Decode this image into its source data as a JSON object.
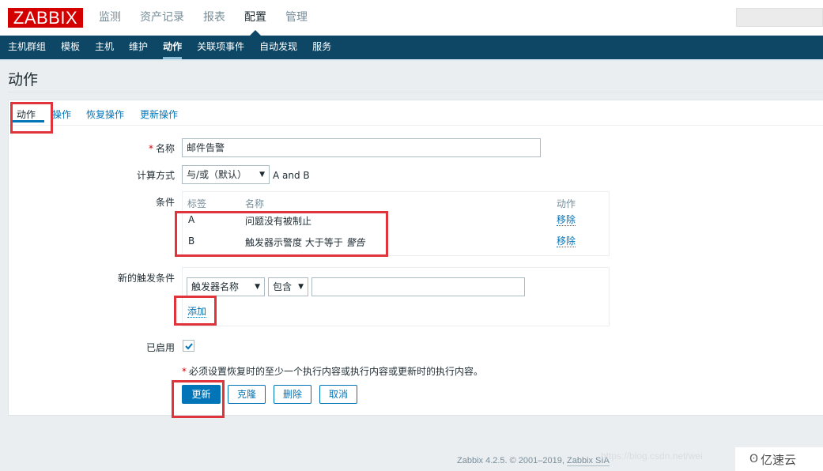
{
  "app": {
    "logo": "ZABBIX",
    "top_menu": [
      {
        "label": "监测",
        "active": false
      },
      {
        "label": "资产记录",
        "active": false
      },
      {
        "label": "报表",
        "active": false
      },
      {
        "label": "配置",
        "active": true
      },
      {
        "label": "管理",
        "active": false
      }
    ],
    "sub_menu": [
      {
        "label": "主机群组",
        "active": false
      },
      {
        "label": "模板",
        "active": false
      },
      {
        "label": "主机",
        "active": false
      },
      {
        "label": "维护",
        "active": false
      },
      {
        "label": "动作",
        "active": true
      },
      {
        "label": "关联项事件",
        "active": false
      },
      {
        "label": "自动发现",
        "active": false
      },
      {
        "label": "服务",
        "active": false
      }
    ]
  },
  "page": {
    "title": "动作",
    "tabs": [
      {
        "label": "动作",
        "active": true
      },
      {
        "label": "操作",
        "active": false
      },
      {
        "label": "恢复操作",
        "active": false
      },
      {
        "label": "更新操作",
        "active": false
      }
    ]
  },
  "form": {
    "name_label": "名称",
    "required_mark": "*",
    "name_value": "邮件告警",
    "calc_label": "计算方式",
    "calc_value": "与/或（默认）",
    "calc_arrow": "▼",
    "calc_expression": "A and B",
    "conditions_label": "条件",
    "conditions_headers": {
      "label": "标签",
      "name": "名称",
      "action": "动作"
    },
    "conditions": [
      {
        "label": "A",
        "name": "问题没有被制止",
        "name_italic": "",
        "action": "移除"
      },
      {
        "label": "B",
        "name": "触发器示警度 大于等于 ",
        "name_italic": "警告",
        "action": "移除"
      }
    ],
    "new_condition_label": "新的触发条件",
    "new_condition_type": "触发器名称",
    "new_condition_operator": "包含",
    "new_condition_value": "",
    "add_link": "添加",
    "enabled_label": "已启用",
    "enabled": true,
    "note": "必须设置恢复时的至少一个执行内容或执行内容或更新时的执行内容。",
    "buttons": {
      "update": "更新",
      "clone": "克隆",
      "delete": "删除",
      "cancel": "取消"
    }
  },
  "footer": {
    "text": "Zabbix 4.2.5. © 2001–2019, ",
    "link": "Zabbix SIA",
    "watermark": "https://blog.csdn.net/wei",
    "brand_icon": "ʘ",
    "brand": "亿速云"
  }
}
